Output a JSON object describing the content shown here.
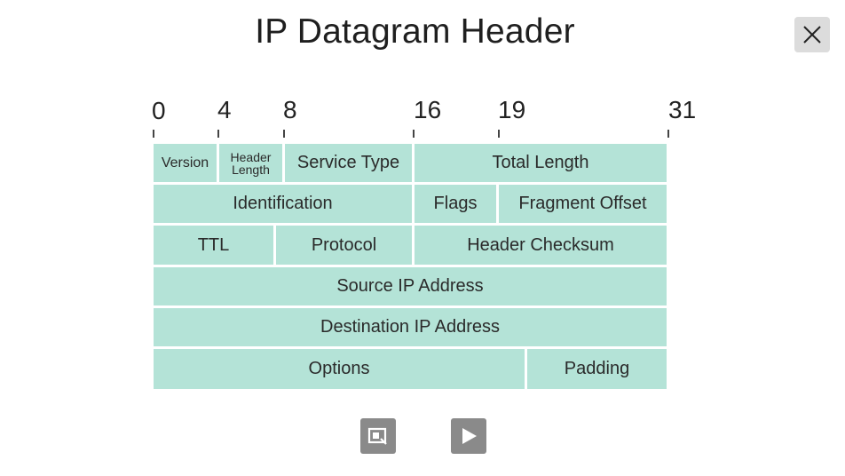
{
  "title": "IP Datagram Header",
  "colors": {
    "field_fill": "#b4e3d7",
    "button_gray": "#8a8a8a",
    "close_bg": "#dcdcdc"
  },
  "icons": {
    "close": "close-icon",
    "zoom": "zoom-image-icon",
    "play": "play-icon"
  },
  "bit_ruler": [
    "0",
    "4",
    "8",
    "16",
    "19",
    "31"
  ],
  "rows": [
    [
      "Version",
      "Header Length",
      "Service Type",
      "Total Length"
    ],
    [
      "Identification",
      "Flags",
      "Fragment Offset"
    ],
    [
      "TTL",
      "Protocol",
      "Header Checksum"
    ],
    [
      "Source IP Address"
    ],
    [
      "Destination IP Address"
    ],
    [
      "Options",
      "Padding"
    ]
  ]
}
